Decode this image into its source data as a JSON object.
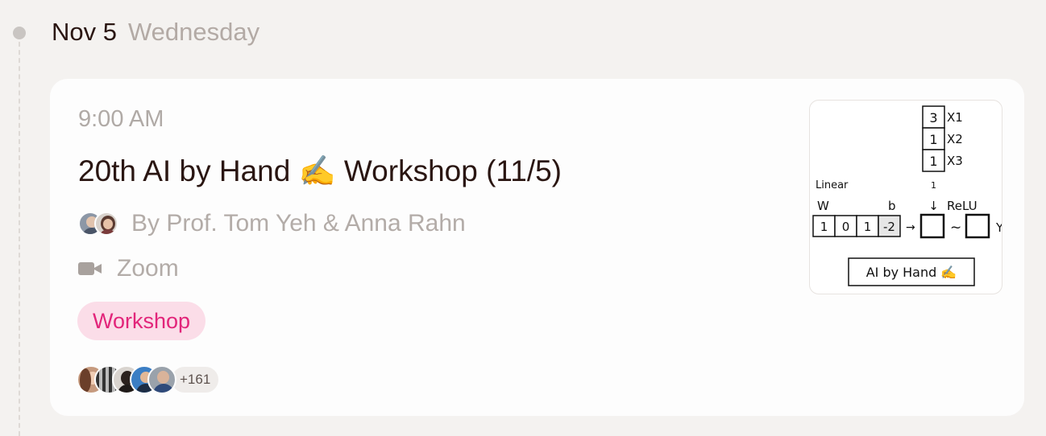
{
  "date": {
    "main": "Nov 5",
    "weekday": "Wednesday"
  },
  "event": {
    "time": "9:00 AM",
    "title": "20th AI by Hand ✍️ Workshop (11/5)",
    "hosts_label": "By Prof. Tom Yeh & Anna Rahn",
    "location": "Zoom",
    "tag": "Workshop",
    "attendees_more": "+161"
  },
  "thumbnail": {
    "x_values": [
      "3",
      "1",
      "1"
    ],
    "x_labels": [
      "X1",
      "X2",
      "X3"
    ],
    "linear_label": "Linear",
    "bias_in": "1",
    "w_label": "W",
    "b_label": "b",
    "relu_label": "ReLU",
    "weights": [
      "1",
      "0",
      "1",
      "-2"
    ],
    "arrow_down": "↓",
    "arrow_right": "→",
    "tilde": "~",
    "y_label": "Y",
    "brand": "AI by Hand ✍️"
  },
  "colors": {
    "tag_bg": "#fbdde8",
    "tag_text": "#e2257a",
    "title": "#2a1612"
  },
  "icons": {
    "location": "video-camera-icon"
  }
}
